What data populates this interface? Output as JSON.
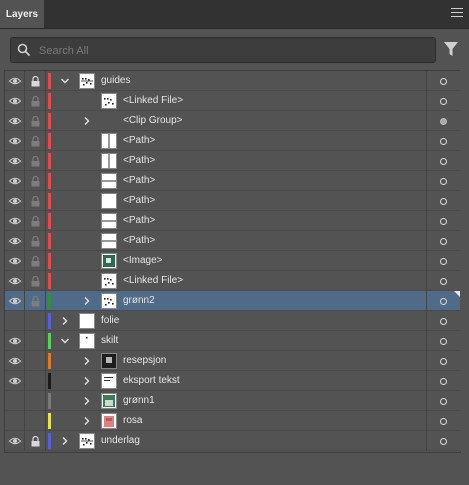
{
  "panel": {
    "tab_label": "Layers"
  },
  "search": {
    "placeholder": "Search All",
    "value": ""
  },
  "icons": {
    "eye": "eye-icon",
    "lock": "lock-icon",
    "expand": "chevron-right-icon",
    "collapse": "chevron-down-icon",
    "search": "search-icon",
    "filter": "filter-icon",
    "menu": "panel-menu-icon",
    "target": "target-circle-icon"
  },
  "layers": [
    {
      "label": "guides",
      "level": 0,
      "visible": true,
      "locked": true,
      "expand": "open",
      "color": "#e44b4b",
      "thumb": "doc",
      "target": "empty",
      "selected": false
    },
    {
      "label": "<Linked File>",
      "level": 1,
      "visible": true,
      "locked": "dim",
      "expand": "none",
      "color": "#e44b4b",
      "thumb": "dots",
      "target": "empty",
      "selected": false
    },
    {
      "label": "<Clip Group>",
      "level": 1,
      "visible": true,
      "locked": "dim",
      "expand": "closed",
      "color": "#e44b4b",
      "thumb": "none",
      "target": "filled",
      "selected": false
    },
    {
      "label": "<Path>",
      "level": 1,
      "visible": true,
      "locked": "dim",
      "expand": "none",
      "color": "#e44b4b",
      "thumb": "vline",
      "target": "empty",
      "selected": false
    },
    {
      "label": "<Path>",
      "level": 1,
      "visible": true,
      "locked": "dim",
      "expand": "none",
      "color": "#e44b4b",
      "thumb": "vline",
      "target": "empty",
      "selected": false
    },
    {
      "label": "<Path>",
      "level": 1,
      "visible": true,
      "locked": "dim",
      "expand": "none",
      "color": "#e44b4b",
      "thumb": "hline",
      "target": "empty",
      "selected": false
    },
    {
      "label": "<Path>",
      "level": 1,
      "visible": true,
      "locked": "dim",
      "expand": "none",
      "color": "#e44b4b",
      "thumb": "blank",
      "target": "empty",
      "selected": false
    },
    {
      "label": "<Path>",
      "level": 1,
      "visible": true,
      "locked": "dim",
      "expand": "none",
      "color": "#e44b4b",
      "thumb": "hline",
      "target": "empty",
      "selected": false
    },
    {
      "label": "<Path>",
      "level": 1,
      "visible": true,
      "locked": "dim",
      "expand": "none",
      "color": "#e44b4b",
      "thumb": "hline",
      "target": "empty",
      "selected": false
    },
    {
      "label": "<Image>",
      "level": 1,
      "visible": true,
      "locked": "dim",
      "expand": "none",
      "color": "#e44b4b",
      "thumb": "green",
      "target": "empty",
      "selected": false
    },
    {
      "label": "<Linked File>",
      "level": 1,
      "visible": true,
      "locked": "dim",
      "expand": "none",
      "color": "#e44b4b",
      "thumb": "dots",
      "target": "empty",
      "selected": false
    },
    {
      "label": "grønn2",
      "level": 1,
      "visible": true,
      "locked": "dim",
      "expand": "closed",
      "color": "#2f8f3a",
      "thumb": "dots",
      "target": "empty",
      "selected": true
    },
    {
      "label": "folie",
      "level": 0,
      "visible": false,
      "locked": false,
      "expand": "closed",
      "color": "#5560e0",
      "thumb": "blank",
      "target": "empty",
      "selected": false
    },
    {
      "label": "skilt",
      "level": 0,
      "visible": true,
      "locked": false,
      "expand": "open",
      "color": "#58d35a",
      "thumb": "dot",
      "target": "empty",
      "selected": false
    },
    {
      "label": "resepsjon",
      "level": 1,
      "visible": true,
      "locked": false,
      "expand": "closed",
      "color": "#e07a24",
      "thumb": "dark",
      "target": "empty",
      "selected": false
    },
    {
      "label": "eksport tekst",
      "level": 1,
      "visible": true,
      "locked": false,
      "expand": "closed",
      "color": "#1a1a1a",
      "thumb": "text",
      "target": "empty",
      "selected": false
    },
    {
      "label": "grønn1",
      "level": 1,
      "visible": false,
      "locked": false,
      "expand": "closed",
      "color": "#7a7a7a",
      "thumb": "green2",
      "target": "empty",
      "selected": false
    },
    {
      "label": "rosa",
      "level": 1,
      "visible": false,
      "locked": false,
      "expand": "closed",
      "color": "#e6e64a",
      "thumb": "pink",
      "target": "empty",
      "selected": false
    },
    {
      "label": "underlag",
      "level": 0,
      "visible": true,
      "locked": true,
      "expand": "closed",
      "color": "#5560e0",
      "thumb": "doc",
      "target": "empty",
      "selected": false
    }
  ]
}
